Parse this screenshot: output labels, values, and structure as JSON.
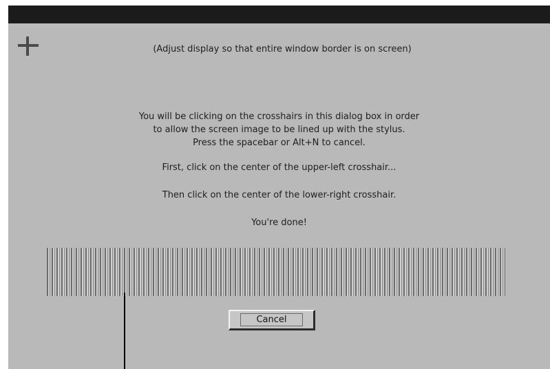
{
  "dialog": {
    "header_note": "(Adjust display so that entire window border is on screen)",
    "instructions": [
      "You will be clicking on the crosshairs in this dialog box in order",
      "to allow the screen image to be lined up with the stylus.",
      "Press the spacebar or Alt+N to cancel."
    ],
    "step1": "First, click on the center of the upper-left crosshair...",
    "step2": "Then click on the center of the lower-right crosshair.",
    "done": "You're done!",
    "cancel_label": "Cancel"
  },
  "icons": {
    "upper_left": "crosshair-icon"
  },
  "colors": {
    "title_bar": "#1b1b1b",
    "dialog_bg": "#b9b9b9",
    "text": "#1e1e1e"
  }
}
